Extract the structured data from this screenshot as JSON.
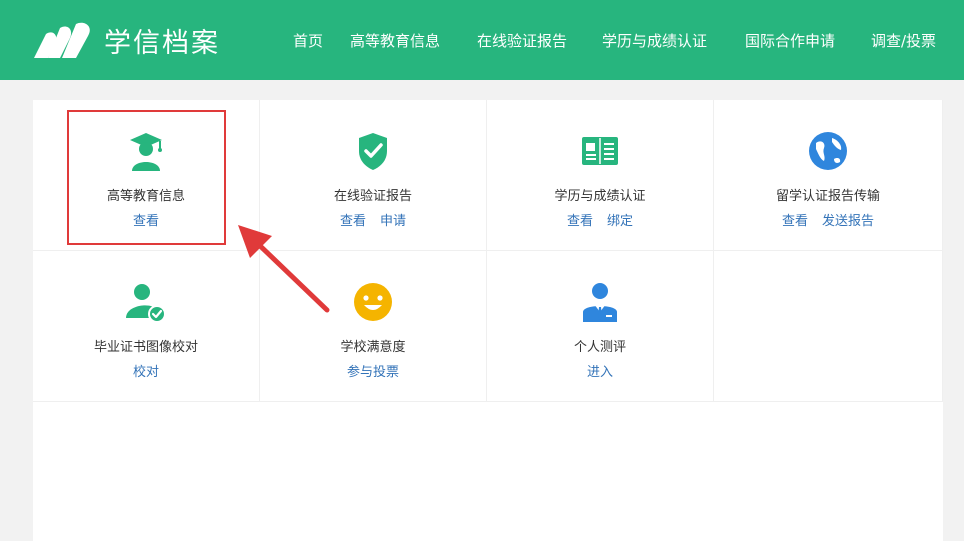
{
  "header": {
    "logo_text": "学信档案",
    "nav": [
      {
        "label": "首页"
      },
      {
        "label": "高等教育信息"
      },
      {
        "label": "在线验证报告"
      },
      {
        "label": "学历与成绩认证"
      },
      {
        "label": "国际合作申请"
      },
      {
        "label": "调查/投票"
      }
    ]
  },
  "colors": {
    "brand_green": "#27b57e",
    "link_blue": "#3373b8",
    "highlight_red": "#e03a3a"
  },
  "tiles": [
    {
      "icon": "graduate-icon",
      "title": "高等教育信息",
      "links": [
        "查看"
      ]
    },
    {
      "icon": "shield-check-icon",
      "title": "在线验证报告",
      "links": [
        "查看",
        "申请"
      ]
    },
    {
      "icon": "book-icon",
      "title": "学历与成绩认证",
      "links": [
        "查看",
        "绑定"
      ]
    },
    {
      "icon": "globe-icon",
      "title": "留学认证报告传输",
      "links": [
        "查看",
        "发送报告"
      ]
    },
    {
      "icon": "user-check-icon",
      "title": "毕业证书图像校对",
      "links": [
        "校对"
      ]
    },
    {
      "icon": "smiley-icon",
      "title": "学校满意度",
      "links": [
        "参与投票"
      ]
    },
    {
      "icon": "person-tie-icon",
      "title": "个人测评",
      "links": [
        "进入"
      ]
    }
  ]
}
